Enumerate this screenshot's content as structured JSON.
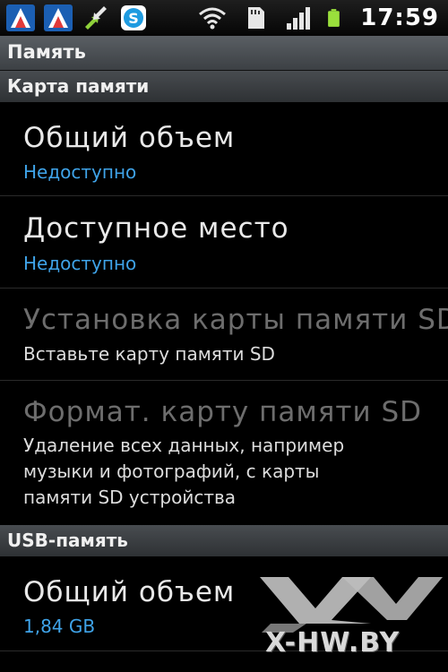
{
  "status_bar": {
    "icons": [
      "notification-app-icon",
      "notification-app-icon",
      "sync-arrows-icon",
      "skype-icon",
      "wifi-icon",
      "sd-card-icon",
      "signal-bars-icon",
      "battery-icon"
    ],
    "time": "17:59"
  },
  "title_bar": {
    "title": "Память"
  },
  "sections": [
    {
      "header": "Карта памяти",
      "items": [
        {
          "title": "Общий объем",
          "summary": "Недоступно",
          "enabled": true
        },
        {
          "title": "Доступное место",
          "summary": "Недоступно",
          "enabled": true
        },
        {
          "title": "Установка карты памяти SD",
          "summary": "Вставьте карту памяти SD",
          "enabled": false
        },
        {
          "title": "Формат. карту памяти SD",
          "summary_lines": [
            "Удаление всех данных, например",
            "музыки и фотографий, с карты",
            "памяти SD устройства"
          ],
          "enabled": false
        }
      ]
    },
    {
      "header": "USB-память",
      "items": [
        {
          "title": "Общий объем",
          "summary": "1,84 GB",
          "enabled": true
        }
      ]
    }
  ],
  "watermark": {
    "text": "X-HW.BY",
    "logo": "xhw-logo"
  },
  "colors": {
    "value_blue": "#3fa3e8",
    "title_bar": "#4a4f54",
    "background": "#000000"
  }
}
